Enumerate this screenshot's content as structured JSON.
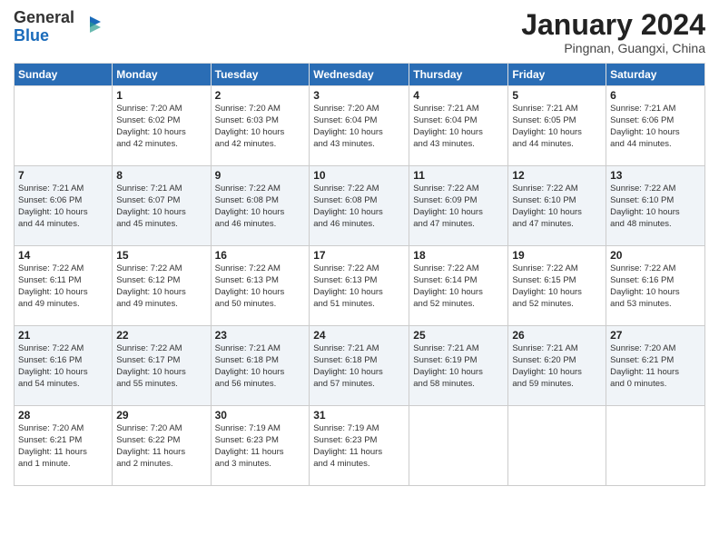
{
  "header": {
    "logo_line1": "General",
    "logo_line2": "Blue",
    "month_title": "January 2024",
    "location": "Pingnan, Guangxi, China"
  },
  "weekdays": [
    "Sunday",
    "Monday",
    "Tuesday",
    "Wednesday",
    "Thursday",
    "Friday",
    "Saturday"
  ],
  "weeks": [
    [
      {
        "day": "",
        "info": ""
      },
      {
        "day": "1",
        "info": "Sunrise: 7:20 AM\nSunset: 6:02 PM\nDaylight: 10 hours\nand 42 minutes."
      },
      {
        "day": "2",
        "info": "Sunrise: 7:20 AM\nSunset: 6:03 PM\nDaylight: 10 hours\nand 42 minutes."
      },
      {
        "day": "3",
        "info": "Sunrise: 7:20 AM\nSunset: 6:04 PM\nDaylight: 10 hours\nand 43 minutes."
      },
      {
        "day": "4",
        "info": "Sunrise: 7:21 AM\nSunset: 6:04 PM\nDaylight: 10 hours\nand 43 minutes."
      },
      {
        "day": "5",
        "info": "Sunrise: 7:21 AM\nSunset: 6:05 PM\nDaylight: 10 hours\nand 44 minutes."
      },
      {
        "day": "6",
        "info": "Sunrise: 7:21 AM\nSunset: 6:06 PM\nDaylight: 10 hours\nand 44 minutes."
      }
    ],
    [
      {
        "day": "7",
        "info": "Sunrise: 7:21 AM\nSunset: 6:06 PM\nDaylight: 10 hours\nand 44 minutes."
      },
      {
        "day": "8",
        "info": "Sunrise: 7:21 AM\nSunset: 6:07 PM\nDaylight: 10 hours\nand 45 minutes."
      },
      {
        "day": "9",
        "info": "Sunrise: 7:22 AM\nSunset: 6:08 PM\nDaylight: 10 hours\nand 46 minutes."
      },
      {
        "day": "10",
        "info": "Sunrise: 7:22 AM\nSunset: 6:08 PM\nDaylight: 10 hours\nand 46 minutes."
      },
      {
        "day": "11",
        "info": "Sunrise: 7:22 AM\nSunset: 6:09 PM\nDaylight: 10 hours\nand 47 minutes."
      },
      {
        "day": "12",
        "info": "Sunrise: 7:22 AM\nSunset: 6:10 PM\nDaylight: 10 hours\nand 47 minutes."
      },
      {
        "day": "13",
        "info": "Sunrise: 7:22 AM\nSunset: 6:10 PM\nDaylight: 10 hours\nand 48 minutes."
      }
    ],
    [
      {
        "day": "14",
        "info": "Sunrise: 7:22 AM\nSunset: 6:11 PM\nDaylight: 10 hours\nand 49 minutes."
      },
      {
        "day": "15",
        "info": "Sunrise: 7:22 AM\nSunset: 6:12 PM\nDaylight: 10 hours\nand 49 minutes."
      },
      {
        "day": "16",
        "info": "Sunrise: 7:22 AM\nSunset: 6:13 PM\nDaylight: 10 hours\nand 50 minutes."
      },
      {
        "day": "17",
        "info": "Sunrise: 7:22 AM\nSunset: 6:13 PM\nDaylight: 10 hours\nand 51 minutes."
      },
      {
        "day": "18",
        "info": "Sunrise: 7:22 AM\nSunset: 6:14 PM\nDaylight: 10 hours\nand 52 minutes."
      },
      {
        "day": "19",
        "info": "Sunrise: 7:22 AM\nSunset: 6:15 PM\nDaylight: 10 hours\nand 52 minutes."
      },
      {
        "day": "20",
        "info": "Sunrise: 7:22 AM\nSunset: 6:16 PM\nDaylight: 10 hours\nand 53 minutes."
      }
    ],
    [
      {
        "day": "21",
        "info": "Sunrise: 7:22 AM\nSunset: 6:16 PM\nDaylight: 10 hours\nand 54 minutes."
      },
      {
        "day": "22",
        "info": "Sunrise: 7:22 AM\nSunset: 6:17 PM\nDaylight: 10 hours\nand 55 minutes."
      },
      {
        "day": "23",
        "info": "Sunrise: 7:21 AM\nSunset: 6:18 PM\nDaylight: 10 hours\nand 56 minutes."
      },
      {
        "day": "24",
        "info": "Sunrise: 7:21 AM\nSunset: 6:18 PM\nDaylight: 10 hours\nand 57 minutes."
      },
      {
        "day": "25",
        "info": "Sunrise: 7:21 AM\nSunset: 6:19 PM\nDaylight: 10 hours\nand 58 minutes."
      },
      {
        "day": "26",
        "info": "Sunrise: 7:21 AM\nSunset: 6:20 PM\nDaylight: 10 hours\nand 59 minutes."
      },
      {
        "day": "27",
        "info": "Sunrise: 7:20 AM\nSunset: 6:21 PM\nDaylight: 11 hours\nand 0 minutes."
      }
    ],
    [
      {
        "day": "28",
        "info": "Sunrise: 7:20 AM\nSunset: 6:21 PM\nDaylight: 11 hours\nand 1 minute."
      },
      {
        "day": "29",
        "info": "Sunrise: 7:20 AM\nSunset: 6:22 PM\nDaylight: 11 hours\nand 2 minutes."
      },
      {
        "day": "30",
        "info": "Sunrise: 7:19 AM\nSunset: 6:23 PM\nDaylight: 11 hours\nand 3 minutes."
      },
      {
        "day": "31",
        "info": "Sunrise: 7:19 AM\nSunset: 6:23 PM\nDaylight: 11 hours\nand 4 minutes."
      },
      {
        "day": "",
        "info": ""
      },
      {
        "day": "",
        "info": ""
      },
      {
        "day": "",
        "info": ""
      }
    ]
  ]
}
